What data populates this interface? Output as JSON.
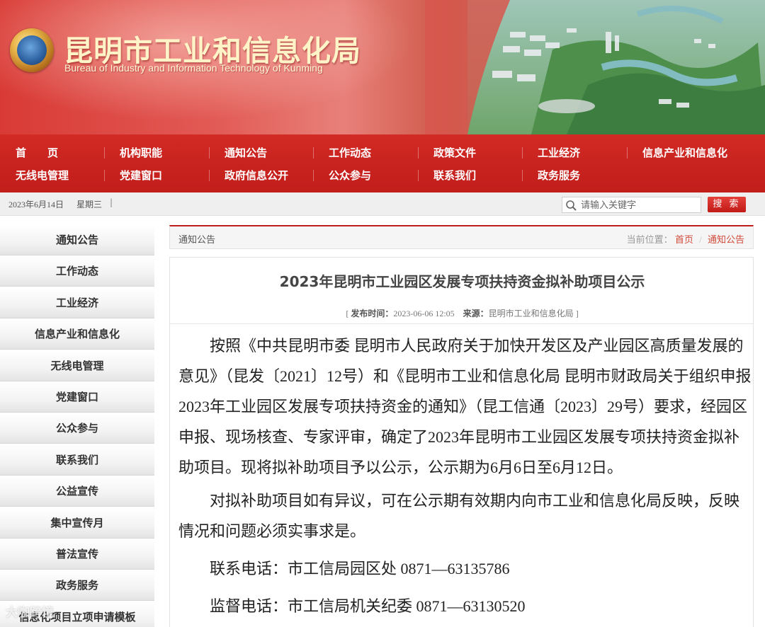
{
  "header": {
    "title_cn": "昆明市工业和信息化局",
    "title_en": "Bureau of Industry and Information Technology of Kunming"
  },
  "nav": {
    "row1": [
      "首　　页",
      "机构职能",
      "通知公告",
      "工作动态",
      "政策文件",
      "工业经济",
      "信息产业和信息化"
    ],
    "row2": [
      "无线电管理",
      "党建窗口",
      "政府信息公开",
      "公众参与",
      "联系我们",
      "政务服务"
    ]
  },
  "infobar": {
    "date": "2023年6月14日",
    "weekday": "星期三",
    "separator": "|"
  },
  "search": {
    "placeholder": "请输入关键字",
    "button_label": "搜 索"
  },
  "sidebar": {
    "items": [
      "通知公告",
      "工作动态",
      "工业经济",
      "信息产业和信息化",
      "无线电管理",
      "党建窗口",
      "公众参与",
      "联系我们",
      "公益宣传",
      "集中宣传月",
      "普法宣传",
      "政务服务",
      "信息化项目立项申请模板"
    ]
  },
  "breadcrumb": {
    "section_title": "通知公告",
    "current_label": "当前位置：",
    "home": "首页",
    "separator": "/",
    "current": "通知公告"
  },
  "article": {
    "title": "2023年昆明市工业园区发展专项扶持资金拟补助项目公示",
    "meta": {
      "open_bracket": "[",
      "publish_label": "发布时间：",
      "publish_time": "2023-06-06 12:05",
      "source_label": "来源：",
      "source": "昆明市工业和信息化局",
      "close_bracket": "]"
    },
    "paragraphs": [
      "按照《中共昆明市委 昆明市人民政府关于加快开发区及产业园区高质量发展的意见》（昆发〔2021〕12号）和《昆明市工业和信息化局 昆明市财政局关于组织申报2023年工业园区发展专项扶持资金的通知》（昆工信通〔2023〕29号）要求，经园区申报、现场核查、专家评审，确定了2023年昆明市工业园区发展专项扶持资金拟补助项目。现将拟补助项目予以公示，公示期为6月6日至6月12日。",
      "对拟补助项目如有异议，可在公示期有效期内向市工业和信息化局反映，反映情况和问题必须实事求是。",
      "联系电话：市工信局园区处 0871—63135786",
      "监督电话：市工信局机关纪委 0871—63130520"
    ]
  },
  "watermark": "大咖跨境",
  "colors": {
    "primary_red": "#c11d1a",
    "link_red": "#d24a3a",
    "banner_gold": "#fff4c8"
  }
}
